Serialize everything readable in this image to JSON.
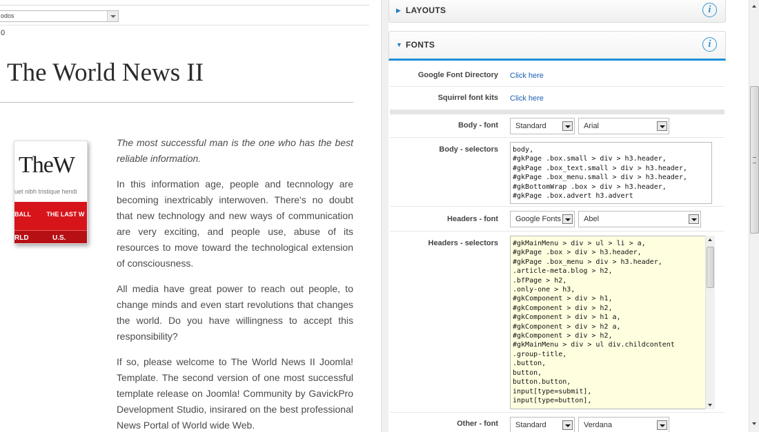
{
  "left": {
    "select_value": "odos",
    "counter": "0",
    "site_title": "The World News II",
    "thumb": {
      "brand": "TheW",
      "tagline": "uet nibh tristique hendi",
      "nav1": "BALL",
      "nav2": "THE LAST W",
      "nav3": "RLD",
      "nav4": "U.S."
    },
    "article": [
      "The most successful man is the one who has the best reliable information.",
      "In this information age, people and tecnnology are becoming inextricably interwoven. There's no doubt that new technology and new ways of communication are very exciting, and people use, abuse of its resources to move toward the technological extension of consciousness.",
      "All media have great power to reach out people, to change minds and even start revolutions that changes the world. Do you have willingness to accept this responsibility?",
      "If so, please welcome to The World News II Joomla! Template. The second version of one most successful template release on Joomla! Community by GavickPro Development Studio, insirared on the best professional News Portal of World wide Web."
    ]
  },
  "right": {
    "accordion": {
      "layouts": "LAYOUTS",
      "fonts": "FONTS",
      "info_glyph": "i"
    },
    "google_font_directory": {
      "label": "Google Font Directory",
      "link": "Click here"
    },
    "squirrel_font_kits": {
      "label": "Squirrel font kits",
      "link": "Click here"
    },
    "body_font": {
      "label": "Body - font",
      "type": "Standard",
      "family": "Arial"
    },
    "body_selectors": {
      "label": "Body - selectors",
      "value": "body,\n#gkPage .box.small > div > h3.header,\n#gkPage .box_text.small > div > h3.header,\n#gkPage .box_menu.small > div > h3.header,\n#gkBottomWrap .box > div > h3.header,\n#gkPage .box.advert h3.advert"
    },
    "headers_font": {
      "label": "Headers - font",
      "type": "Google Fonts",
      "family": "Abel"
    },
    "headers_selectors": {
      "label": "Headers - selectors",
      "value": "#gkMainMenu > div > ul > li > a,\n#gkPage .box > div > h3.header,\n#gkPage .box_menu > div > h3.header,\n.article-meta.blog > h2,\n.bfPage > h2,\n.only-one > h3,\n#gkComponent > div > h1,\n#gkComponent > div > h2,\n#gkComponent > div > h1 a,\n#gkComponent > div > h2 a,\n#gkComponent > div > h2,\n#gkMainMenu > div > ul div.childcontent\n.group-title,\n.button,\nbutton,\nbutton.button,\ninput[type=submit],\ninput[type=button],"
    },
    "other_font": {
      "label": "Other - font",
      "type": "Standard",
      "family": "Verdana"
    }
  },
  "colors": {
    "accent": "#1d8fd6",
    "link": "#1a5fb4",
    "highlight_textarea": "#ffffe0"
  }
}
